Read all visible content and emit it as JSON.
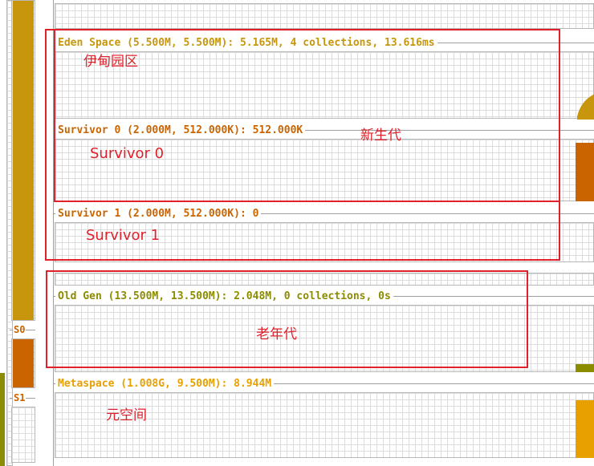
{
  "colors": {
    "eden": "#c8960c",
    "survivor": "#c96400",
    "old": "#8c8c00",
    "metaspace": "#e8a000",
    "annotation": "#e0202a",
    "grid_line": "#dcdcdc"
  },
  "left_panel": {
    "s0_label": "S0",
    "s1_label": "S1"
  },
  "sections": {
    "eden": {
      "title": "Eden Space (5.500M, 5.500M): 5.165M, 4 collections, 13.616ms",
      "fill_fraction": 0.94
    },
    "survivor0": {
      "title": "Survivor 0 (2.000M, 512.000K): 512.000K",
      "fill_fraction": 1.0
    },
    "survivor1": {
      "title": "Survivor 1 (2.000M, 512.000K): 0",
      "fill_fraction": 0.0
    },
    "old_gen": {
      "title": "Old Gen (13.500M, 13.500M): 2.048M, 0 collections, 0s",
      "fill_fraction": 0.15
    },
    "metaspace": {
      "title": "Metaspace (1.008G, 9.500M): 8.944M",
      "fill_fraction": 0.94
    }
  },
  "annotations": {
    "eden": "伊甸园区",
    "young_gen": "新生代",
    "survivor0": "Survivor 0",
    "survivor1": "Survivor 1",
    "old_gen": "老年代",
    "metaspace": "元空间"
  }
}
